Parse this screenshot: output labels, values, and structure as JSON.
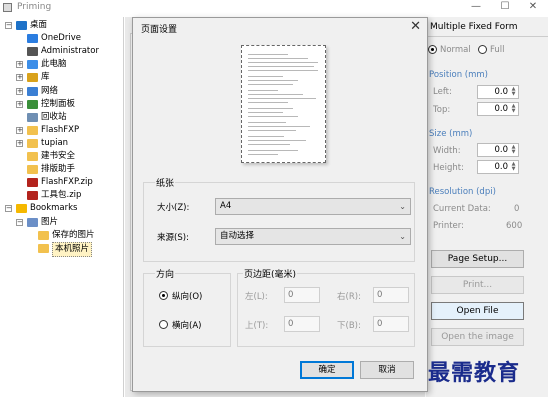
{
  "window": {
    "title": "Priming",
    "minimize": "—",
    "maximize": "☐",
    "close": "✕"
  },
  "tree": {
    "items": [
      {
        "label": "桌面",
        "icon": "desktop-icon",
        "expander": "−",
        "color": "#1e72c8"
      },
      {
        "label": "OneDrive",
        "icon": "cloud-icon",
        "color": "#2b7de0"
      },
      {
        "label": "Administrator",
        "icon": "user-icon",
        "color": "#555555"
      },
      {
        "label": "此电脑",
        "icon": "computer-icon",
        "expander": "+",
        "color": "#3c8ee8"
      },
      {
        "label": "库",
        "icon": "library-icon",
        "expander": "+",
        "color": "#d9a21b"
      },
      {
        "label": "网络",
        "icon": "network-icon",
        "expander": "+",
        "color": "#3b7fd4"
      },
      {
        "label": "控制面板",
        "icon": "control-panel-icon",
        "expander": "+",
        "color": "#3a8f3a"
      },
      {
        "label": "回收站",
        "icon": "recycle-bin-icon",
        "color": "#6f8fb3"
      },
      {
        "label": "FlashFXP",
        "icon": "folder-icon",
        "expander": "+",
        "color": "#f2c14e"
      },
      {
        "label": "tupian",
        "icon": "folder-icon",
        "expander": "+",
        "color": "#f2c14e"
      },
      {
        "label": "建书安全",
        "icon": "folder-icon",
        "color": "#f2c14e"
      },
      {
        "label": "排版助手",
        "icon": "folder-icon",
        "color": "#f2c14e"
      },
      {
        "label": "FlashFXP.zip",
        "icon": "zip-icon",
        "color": "#b3231d"
      },
      {
        "label": "工具包.zip",
        "icon": "zip-icon",
        "color": "#b3231d"
      },
      {
        "label": "Bookmarks",
        "icon": "star-icon",
        "expander": "−",
        "color": "#f5b800"
      },
      {
        "label": "图片",
        "icon": "image-folder-icon",
        "expander": "−",
        "color": "#6b8fc7"
      },
      {
        "label": "保存的图片",
        "icon": "folder-icon",
        "color": "#f2c14e"
      },
      {
        "label": "本机照片",
        "icon": "folder-icon",
        "color": "#f2c14e",
        "selected": true
      }
    ]
  },
  "right_panel": {
    "title": "Multiple Fixed Form",
    "mode_normal": "Normal",
    "mode_full": "Full",
    "position_heading": "Position (mm)",
    "left_label": "Left:",
    "left_value": "0.0",
    "top_label": "Top:",
    "top_value": "0.0",
    "size_heading": "Size (mm)",
    "width_label": "Width:",
    "width_value": "0.0",
    "height_label": "Height:",
    "height_value": "0.0",
    "resolution_heading": "Resolution (dpi)",
    "current_data_label": "Current Data:",
    "current_data_value": "0",
    "printer_label": "Printer:",
    "printer_value": "600",
    "page_setup_button": "Page Setup...",
    "print_button": "Print...",
    "open_file_button": "Open File",
    "open_image_button": "Open the image"
  },
  "dialog": {
    "title": "页面设置",
    "close": "✕",
    "paper_group": "纸张",
    "size_label": "大小(Z):",
    "size_value": "A4",
    "source_label": "来源(S):",
    "source_value": "自动选择",
    "orientation_group": "方向",
    "portrait_label": "纵向(O)",
    "landscape_label": "横向(A)",
    "orientation_selected": "portrait",
    "margins_group": "页边距(毫米)",
    "left_label": "左(L):",
    "left_value": "0",
    "right_label": "右(R):",
    "right_value": "0",
    "top_label": "上(T):",
    "top_value": "0",
    "bottom_label": "下(B):",
    "bottom_value": "0",
    "ok_button": "确定",
    "cancel_button": "取消"
  },
  "watermark": "最需教育"
}
